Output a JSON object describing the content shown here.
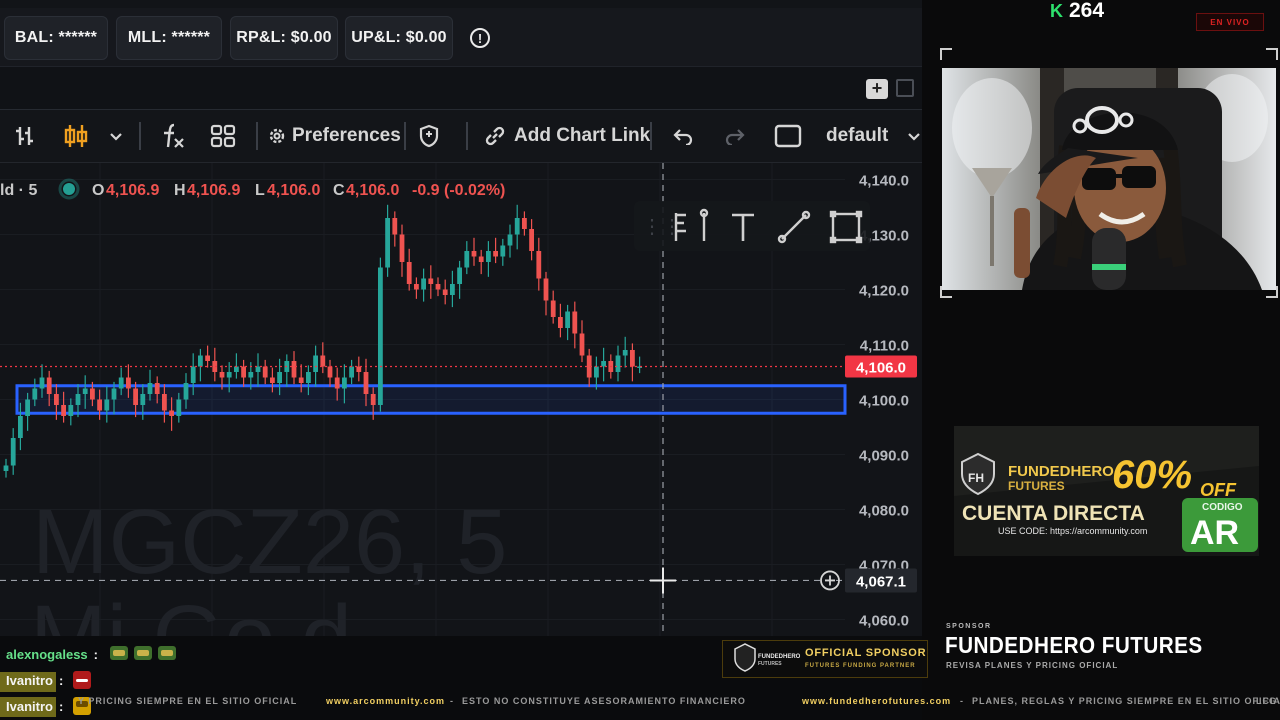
{
  "account_bar": {
    "balance": "BAL: ******",
    "mll": "MLL: ******",
    "realized_pnl": "RP&L: $0.00",
    "unrealized_pnl": "UP&L: $0.00",
    "info_icon": "!"
  },
  "toolbar": {
    "preferences_label": "Preferences",
    "add_chart_link_label": "Add Chart Link",
    "layout_label": "default",
    "icons": [
      "bar-style-icon",
      "candles-icon",
      "chevron-down-icon",
      "indicators-icon",
      "layout-grid-icon",
      "gear-icon",
      "shield-icon",
      "link-icon",
      "undo-icon",
      "redo-icon",
      "screenshot-icon",
      "chevron-down-icon"
    ]
  },
  "tabstrip": {
    "add_label": "+"
  },
  "legend": {
    "symbol_fragment": "ld · 5",
    "open_prefix": "O",
    "open": "4,106.9",
    "high_prefix": "H",
    "high": "4,106.9",
    "low_prefix": "L",
    "low": "4,106.0",
    "close_prefix": "C",
    "close": "4,106.0",
    "change": "-0.9 (-0.02%)"
  },
  "watermark": {
    "line1": "MGCZ26, 5",
    "line2": "Mi Go d"
  },
  "drawing_tools": [
    "flag-pin-icon",
    "text-icon",
    "trendline-icon",
    "rectangle-icon"
  ],
  "chart_data": {
    "type": "candlestick",
    "symbol": "MGCZ26",
    "interval": "5",
    "ylim": [
      4057,
      4143
    ],
    "y_ticks": [
      "4,140.0",
      "4,130.0",
      "4,120.0",
      "4,110.0",
      "4,100.0",
      "4,090.0",
      "4,080.0",
      "4,070.0",
      "4,060.0"
    ],
    "y_tick_values": [
      4140,
      4130,
      4120,
      4110,
      4100,
      4090,
      4080,
      4070,
      4060
    ],
    "last_price": 4106.0,
    "last_price_label": "4,106.0",
    "crosshair_price": 4067.1,
    "crosshair_label": "4,067.1",
    "zone": {
      "low": 4097.5,
      "high": 4102.5
    },
    "approx_closes": [
      4088,
      4093,
      4097,
      4100,
      4102,
      4104,
      4101,
      4099,
      4097,
      4099,
      4101,
      4102,
      4100,
      4098,
      4100,
      4102,
      4104,
      4102,
      4099,
      4101,
      4103,
      4101,
      4098,
      4097,
      4100,
      4103,
      4106,
      4108,
      4107,
      4105,
      4104,
      4105,
      4106,
      4104,
      4105,
      4106,
      4104,
      4103,
      4105,
      4107,
      4104,
      4103,
      4105,
      4108,
      4106,
      4104,
      4102,
      4104,
      4106,
      4105,
      4101,
      4099,
      4124,
      4133,
      4130,
      4125,
      4121,
      4120,
      4122,
      4121,
      4120,
      4119,
      4121,
      4124,
      4127,
      4126,
      4125,
      4127,
      4126,
      4128,
      4130,
      4133,
      4131,
      4127,
      4122,
      4118,
      4115,
      4113,
      4116,
      4112,
      4108,
      4104,
      4106,
      4107,
      4105,
      4108,
      4109,
      4106,
      4106
    ]
  },
  "stream": {
    "viewer_count": "264",
    "viewer_icon": "K",
    "live_label": "EN VIVO",
    "ad": {
      "brand": "FUNDEDHERO",
      "brand_line2": "FUTURES",
      "discount": "60%",
      "off": "OFF",
      "headline": "CUENTA DIRECTA",
      "use_code": "USE CODE: https://arcommunity.com",
      "code_label": "CODIGO",
      "code": "AR"
    },
    "sponsor_small": "SPONSOR",
    "sponsor_name": "FUNDEDHERO FUTURES",
    "sponsor_sub": "REVISA PLANES Y PRICING OFICIAL",
    "badge_title": "OFFICIAL SPONSOR",
    "badge_sub": "FUTURES FUNDING PARTNER",
    "badge_brand": "FUNDEDHERO",
    "badge_brand2": "FUTURES"
  },
  "chat": [
    {
      "user": "alexnogaless",
      "sep": ":"
    },
    {
      "user": "Ivanitro",
      "sep": ":"
    },
    {
      "user": "Ivanitro",
      "sep": ":"
    }
  ],
  "ticker": {
    "part1": "Y PRICING SIEMPRE EN EL SITIO OFICIAL",
    "site1": "www.arcommunity.com",
    "part2": "ESTO NO CONSTITUYE ASESORAMIENTO FINANCIERO",
    "site2": "www.fundedherofutures.com",
    "part3": "PLANES, REGLAS Y PRICING SIEMPRE EN EL SITIO OFICIAL",
    "part4": "LFG"
  },
  "colors": {
    "up": "#26a69a",
    "down": "#ef5350",
    "zone": "#2962ff",
    "price_tag": "#f23645"
  }
}
